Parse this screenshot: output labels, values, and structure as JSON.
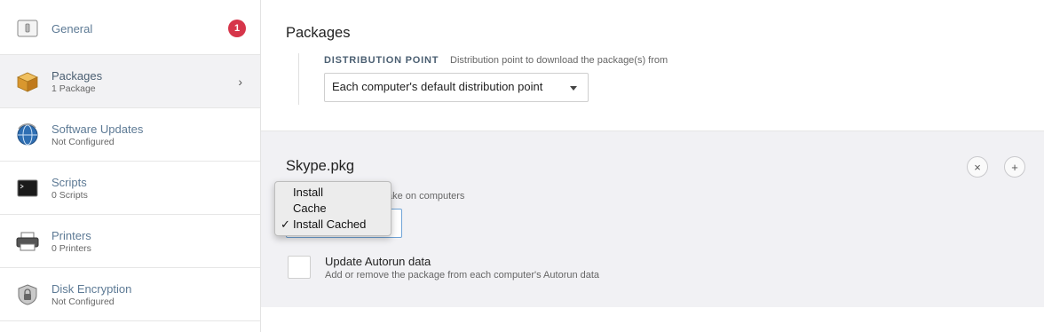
{
  "sidebar": {
    "items": [
      {
        "label": "General",
        "sublabel": "",
        "icon": "general-icon",
        "badge": "1"
      },
      {
        "label": "Packages",
        "sublabel": "1 Package",
        "icon": "package-box-icon"
      },
      {
        "label": "Software Updates",
        "sublabel": "Not Configured",
        "icon": "software-update-globe-icon"
      },
      {
        "label": "Scripts",
        "sublabel": "0 Scripts",
        "icon": "terminal-icon"
      },
      {
        "label": "Printers",
        "sublabel": "0 Printers",
        "icon": "printer-icon"
      },
      {
        "label": "Disk Encryption",
        "sublabel": "Not Configured",
        "icon": "disk-encryption-lock-icon"
      }
    ],
    "active_chevron": "›"
  },
  "packages": {
    "title": "Packages",
    "distribution_point": {
      "label": "DISTRIBUTION POINT",
      "help": "Distribution point to download the package(s) from",
      "selected": "Each computer's default distribution point"
    }
  },
  "package_item": {
    "name": "Skype.pkg",
    "remove_icon": "×",
    "add_icon": "+",
    "action_help": "ake on computers",
    "action_menu": {
      "options": [
        "Install",
        "Cache",
        "Install Cached"
      ],
      "selected_index": 2,
      "check_glyph": "✓"
    },
    "autorun": {
      "title": "Update Autorun data",
      "description": "Add or remove the package from each computer's Autorun data"
    }
  },
  "colors": {
    "badge": "#d6354a",
    "sidebar_link": "#5d7a95",
    "panel_bg": "#f1f1f4",
    "focus_border": "#6fa3d6"
  }
}
